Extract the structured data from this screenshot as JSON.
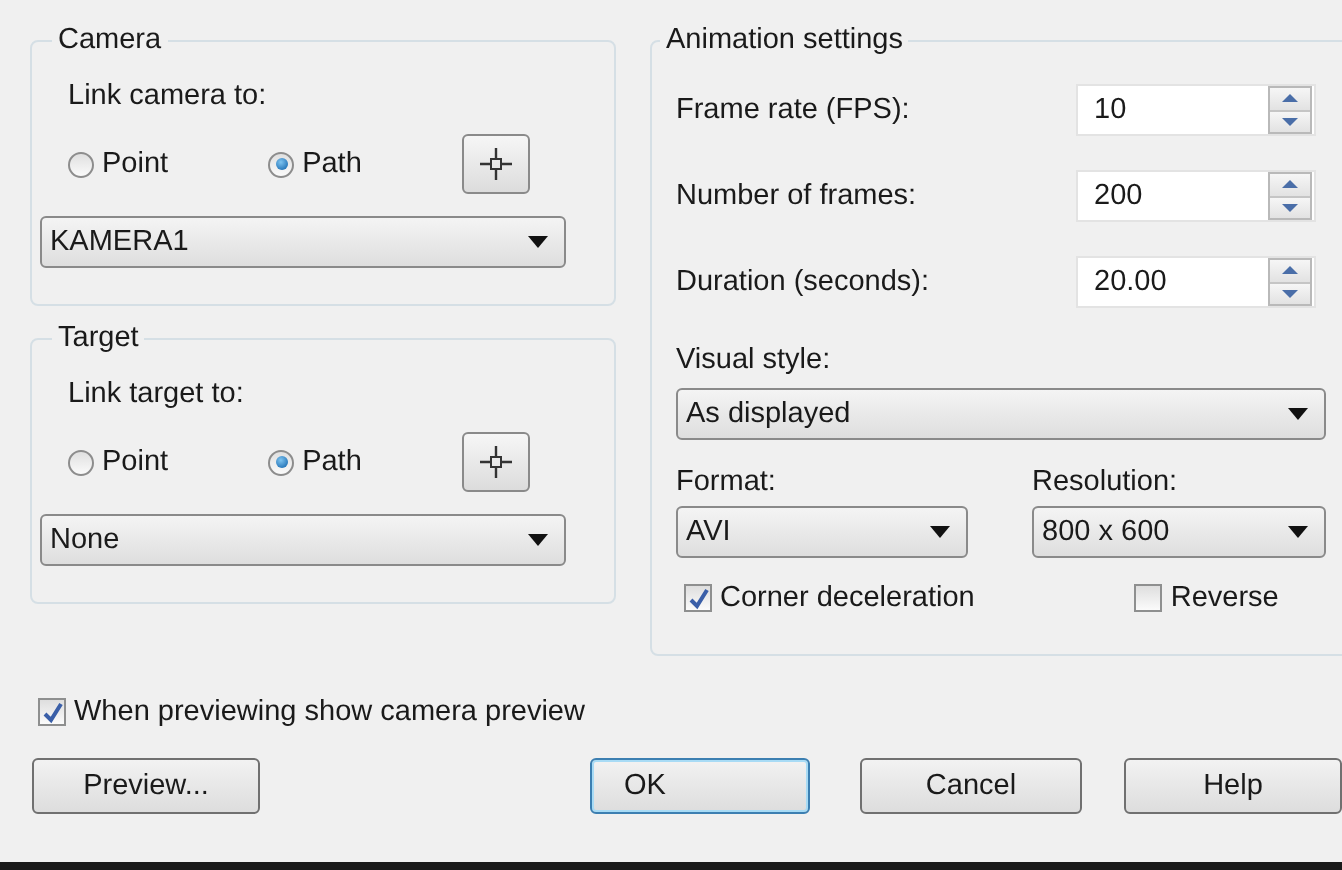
{
  "camera": {
    "title": "Camera",
    "link_label": "Link camera to:",
    "options": [
      {
        "label": "Point",
        "selected": false
      },
      {
        "label": "Path",
        "selected": true
      }
    ],
    "dropdown": {
      "value": "KAMERA1"
    }
  },
  "target": {
    "title": "Target",
    "link_label": "Link target to:",
    "options": [
      {
        "label": "Point",
        "selected": false
      },
      {
        "label": "Path",
        "selected": true
      }
    ],
    "dropdown": {
      "value": "None"
    }
  },
  "animation": {
    "title": "Animation settings",
    "fields": [
      {
        "label": "Frame rate (FPS):",
        "value": "10"
      },
      {
        "label": "Number of frames:",
        "value": "200"
      },
      {
        "label": "Duration (seconds):",
        "value": "20.00"
      }
    ],
    "visual_style": {
      "label": "Visual style:",
      "value": "As displayed"
    },
    "format": {
      "label": "Format:",
      "value": "AVI"
    },
    "resolution": {
      "label": "Resolution:",
      "value": "800 x 600"
    },
    "checks": [
      {
        "label": "Corner deceleration",
        "checked": true
      },
      {
        "label": "Reverse",
        "checked": false
      }
    ]
  },
  "preview_check": {
    "label": "When previewing show camera preview",
    "checked": true
  },
  "buttons": [
    {
      "label": "Preview...",
      "default": false
    },
    {
      "label": "OK",
      "default": true
    },
    {
      "label": "Cancel",
      "default": false
    },
    {
      "label": "Help",
      "default": false
    }
  ]
}
